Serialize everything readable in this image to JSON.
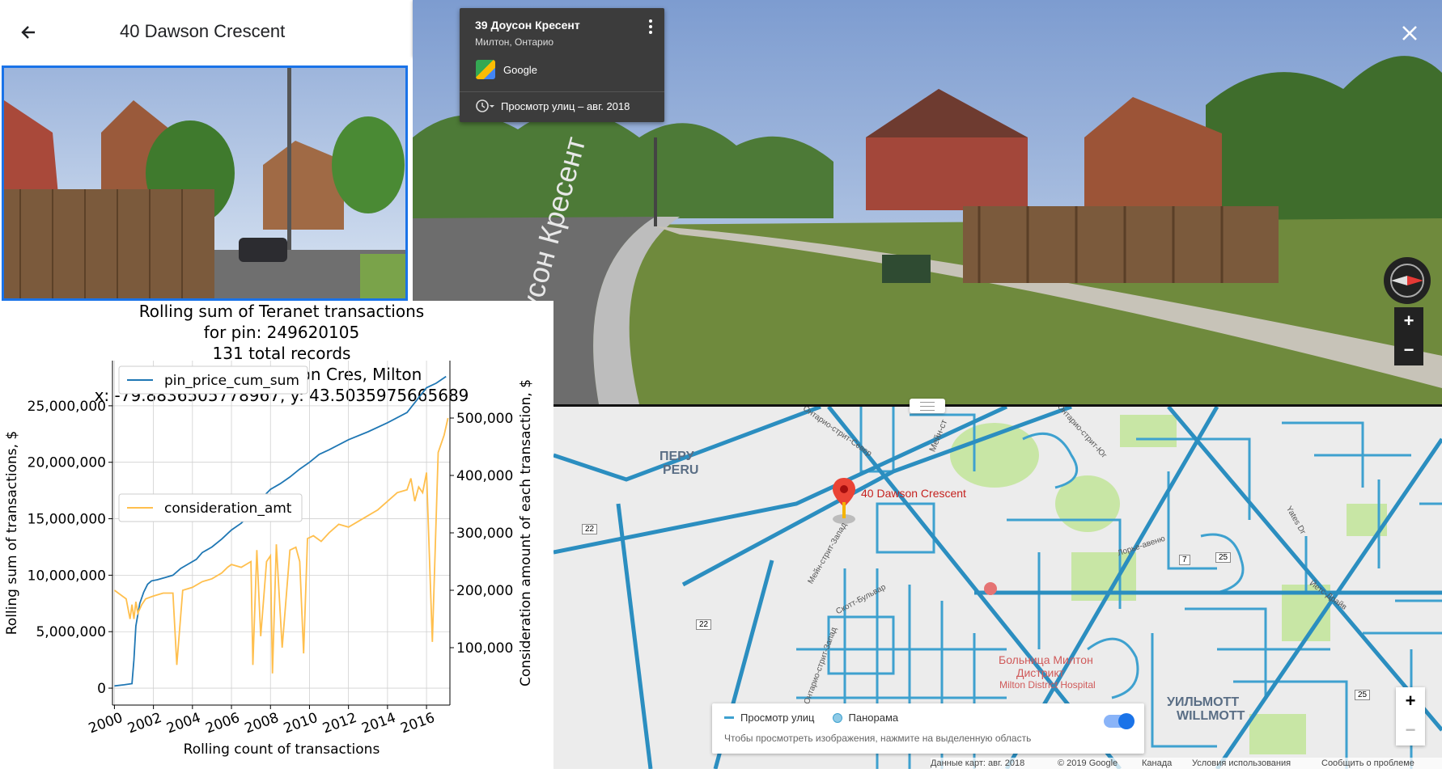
{
  "place_panel": {
    "title": "40 Dawson Crescent"
  },
  "streetview": {
    "card_title": "39 Доусон Кресент",
    "card_subtitle": "Милтон, Онтарио",
    "provider": "Google",
    "date_label": "Просмотр улиц – авг. 2018",
    "road_sign_text": "Доусон Кресент"
  },
  "map": {
    "place_labels": {
      "peru_ru": "ПЕРУ",
      "peru_en": "PERU",
      "willmott_ru": "УИЛЬМОТТ",
      "willmott_en": "WILLMOTT",
      "hospital_ru_1": "Больница Милтон",
      "hospital_ru_2": "Дистрикт",
      "hospital_en": "Milton District Hospital"
    },
    "street_labels": {
      "main_east": "Мейн-ст",
      "main_west": "Мейн-стрит-Запад",
      "scott": "Скотт-Бульвар",
      "ontario_north": "Онтарио-стрит-Север",
      "ontario_south": "Онтарио-стрит-Юг",
      "laurier": "Лорье-авеню",
      "yates": "Йетс-Драйв",
      "yates_short": "Yates Dr",
      "ontario_west": "Онтарио-стрит-Запад"
    },
    "route_shields": [
      "22",
      "22",
      "7",
      "25",
      "25"
    ],
    "marker_label": "40 Dawson Crescent",
    "legend": {
      "streetview_label": "Просмотр улиц",
      "panorama_label": "Панорама",
      "hint": "Чтобы просмотреть изображения, нажмите на выделенную область"
    },
    "footer": {
      "data_label": "Данные карт: авг. 2018",
      "copyright": "© 2019 Google",
      "country": "Канада",
      "terms": "Условия использования",
      "report": "Сообщить о проблеме"
    },
    "colors": {
      "road": "#3ea1cf",
      "park": "#c8e6a5",
      "marker": "#ea4335"
    }
  },
  "chart_data": {
    "type": "line",
    "title_lines": [
      "Rolling sum of Teranet transactions",
      "for pin: 249620105",
      "131 total records",
      "address: 40.0 Dawson Cres, Milton",
      "x: -79.8836505778967, y: 43.5035975665689"
    ],
    "xlabel": "Rolling count of transactions",
    "ylabel_left": "Rolling sum of transactions, $",
    "ylabel_right": "Consideration amount of each transaction, $",
    "x_ticks": [
      "2000",
      "2002",
      "2004",
      "2006",
      "2008",
      "2010",
      "2012",
      "2014",
      "2016"
    ],
    "xlim": [
      1999.9,
      2017.2
    ],
    "ylim_left": [
      -1500000,
      29000000
    ],
    "ylim_right": [
      0,
      600000
    ],
    "y_left_ticks": [
      "0",
      "5,000,000",
      "10,000,000",
      "15,000,000",
      "20,000,000",
      "25,000,000"
    ],
    "y_left_tick_values": [
      0,
      5000000,
      10000000,
      15000000,
      20000000,
      25000000
    ],
    "y_right_ticks": [
      "100,000",
      "200,000",
      "300,000",
      "400,000",
      "500,000"
    ],
    "y_right_tick_values": [
      100000,
      200000,
      300000,
      400000,
      500000
    ],
    "grid": true,
    "legend_position": "upper-left",
    "series": [
      {
        "name": "pin_price_cum_sum",
        "axis": "left",
        "color": "#1f77b4",
        "x": [
          2000.0,
          2000.5,
          2000.9,
          2001.0,
          2001.1,
          2001.3,
          2001.5,
          2001.7,
          2001.9,
          2002.2,
          2002.6,
          2003.0,
          2003.4,
          2003.8,
          2004.2,
          2004.5,
          2005.0,
          2005.5,
          2006.0,
          2006.5,
          2006.9,
          2007.3,
          2007.6,
          2008.0,
          2008.5,
          2009.0,
          2009.5,
          2010.0,
          2010.5,
          2011.0,
          2012.0,
          2013.0,
          2014.0,
          2015.0,
          2015.5,
          2016.0,
          2016.5,
          2017.0
        ],
        "y": [
          200000,
          300000,
          400000,
          2500000,
          5500000,
          7500000,
          8500000,
          9200000,
          9500000,
          9600000,
          9800000,
          10000000,
          10600000,
          11000000,
          11400000,
          12000000,
          12500000,
          13200000,
          14000000,
          14600000,
          15300000,
          15800000,
          16900000,
          17600000,
          18100000,
          18700000,
          19400000,
          20000000,
          20700000,
          21100000,
          22000000,
          22700000,
          23500000,
          24400000,
          25500000,
          26600000,
          27000000,
          27600000
        ]
      },
      {
        "name": "consideration_amt",
        "axis": "right",
        "color": "#ffbf4d",
        "x": [
          2000.0,
          2000.6,
          2000.8,
          2000.9,
          2001.0,
          2001.1,
          2001.2,
          2001.4,
          2001.6,
          2002.0,
          2002.5,
          2003.0,
          2003.2,
          2003.5,
          2004.0,
          2004.5,
          2005.0,
          2005.5,
          2005.8,
          2006.0,
          2006.5,
          2007.0,
          2007.1,
          2007.3,
          2007.5,
          2007.8,
          2008.0,
          2008.1,
          2008.3,
          2008.6,
          2009.0,
          2009.3,
          2009.5,
          2009.7,
          2009.9,
          2010.2,
          2010.6,
          2011.0,
          2011.5,
          2012.0,
          2012.5,
          2013.0,
          2013.5,
          2014.0,
          2014.5,
          2015.0,
          2015.2,
          2015.4,
          2015.6,
          2015.8,
          2016.0,
          2016.3,
          2016.6,
          2016.9,
          2017.1
        ],
        "y": [
          200000,
          185000,
          150000,
          175000,
          150000,
          180000,
          160000,
          175000,
          185000,
          190000,
          195000,
          195000,
          70000,
          200000,
          205000,
          215000,
          220000,
          230000,
          240000,
          245000,
          240000,
          250000,
          70000,
          270000,
          120000,
          250000,
          260000,
          55000,
          280000,
          100000,
          270000,
          275000,
          250000,
          90000,
          290000,
          295000,
          285000,
          300000,
          315000,
          310000,
          320000,
          330000,
          340000,
          355000,
          370000,
          375000,
          395000,
          355000,
          380000,
          370000,
          405000,
          110000,
          440000,
          470000,
          500000
        ]
      }
    ]
  }
}
